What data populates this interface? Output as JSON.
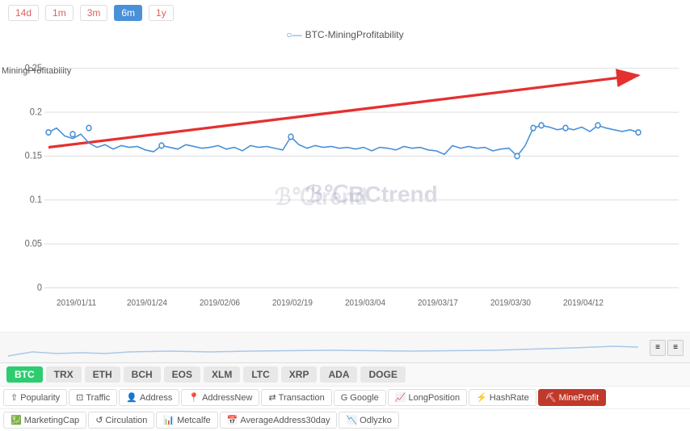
{
  "timePeriods": [
    {
      "label": "14d",
      "active": false
    },
    {
      "label": "1m",
      "active": false
    },
    {
      "label": "3m",
      "active": false
    },
    {
      "label": "6m",
      "active": true
    },
    {
      "label": "1y",
      "active": false
    }
  ],
  "legend": {
    "icon": "○—",
    "text": "BTC-MiningProfitability"
  },
  "yAxis": {
    "label": "MiningProfitability",
    "ticks": [
      "0.25",
      "0.2",
      "0.15",
      "0.1",
      "0.05",
      "0"
    ]
  },
  "xAxis": {
    "ticks": [
      "2019/01/11",
      "2019/01/24",
      "2019/02/06",
      "2019/02/19",
      "2019/03/04",
      "2019/03/17",
      "2019/03/30",
      "2019/04/12"
    ]
  },
  "watermark": "BCtrend",
  "coins": [
    {
      "label": "BTC",
      "active": true
    },
    {
      "label": "TRX",
      "active": false
    },
    {
      "label": "ETH",
      "active": false
    },
    {
      "label": "BCH",
      "active": false
    },
    {
      "label": "EOS",
      "active": false
    },
    {
      "label": "XLM",
      "active": false
    },
    {
      "label": "LTC",
      "active": false
    },
    {
      "label": "XRP",
      "active": false
    },
    {
      "label": "ADA",
      "active": false
    },
    {
      "label": "DOGE",
      "active": false
    }
  ],
  "metrics1": [
    {
      "icon": "↑",
      "label": "Popularity"
    },
    {
      "icon": "⊡",
      "label": "Traffic"
    },
    {
      "icon": "👤",
      "label": "Address"
    },
    {
      "icon": "📍",
      "label": "AddressNew"
    },
    {
      "icon": "⇄",
      "label": "Transaction"
    },
    {
      "icon": "G",
      "label": "Google"
    },
    {
      "icon": "📈",
      "label": "LongPosition"
    },
    {
      "icon": "⚡",
      "label": "HashRate"
    },
    {
      "icon": "⛏",
      "label": "MineProfit",
      "active": true
    }
  ],
  "metrics2": [
    {
      "icon": "💹",
      "label": "MarketingCap"
    },
    {
      "icon": "↺",
      "label": "Circulation"
    },
    {
      "icon": "📊",
      "label": "Metcalfe"
    },
    {
      "icon": "📅",
      "label": "AverageAddress30day"
    },
    {
      "icon": "📉",
      "label": "Odlyzko"
    }
  ]
}
